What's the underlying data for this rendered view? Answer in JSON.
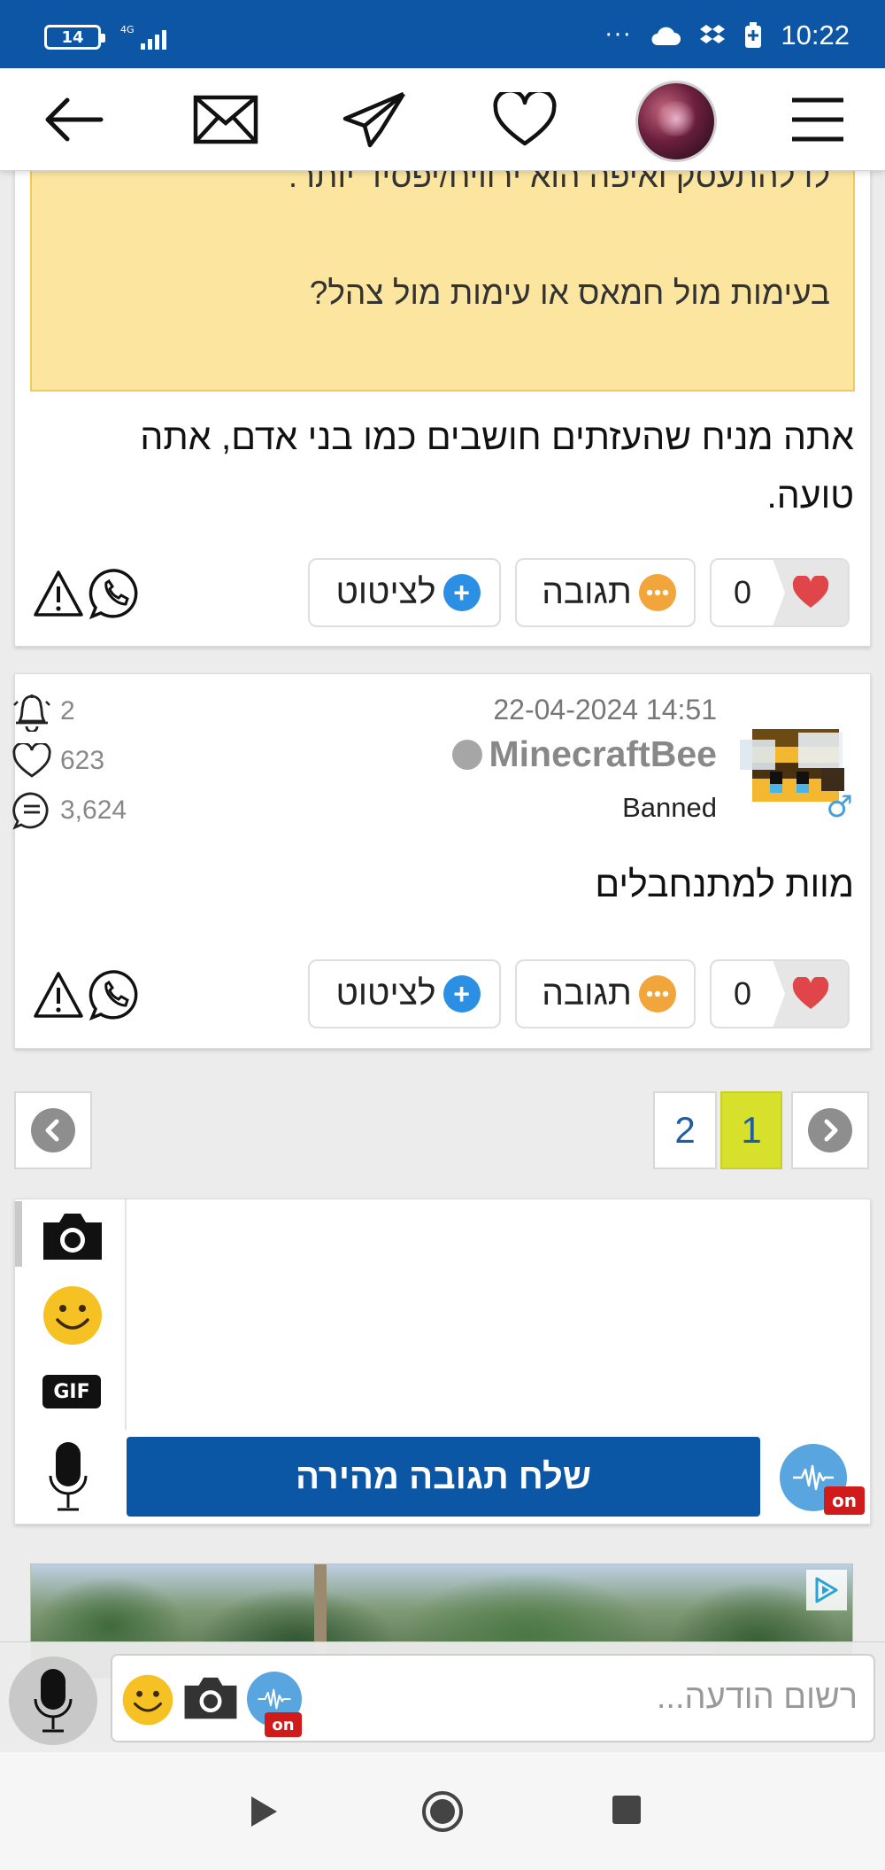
{
  "status_bar": {
    "battery": "14",
    "network": "4G",
    "time": "10:22",
    "icons": [
      "more-dots-icon",
      "cloud-icon",
      "dropbox-icon",
      "battery-saver-icon"
    ]
  },
  "app_bar": {
    "icons": [
      "back-arrow-icon",
      "envelope-icon",
      "paper-plane-icon",
      "heart-icon",
      "user-avatar",
      "hamburger-menu-icon"
    ]
  },
  "post1": {
    "quote_lines": [
      "לו להתעסק ואיפה הוא ירוויח/יפסיד יותר.",
      "בעימות מול חמאס או עימות מול צהל?"
    ],
    "text_lines": [
      "אתה מניח שהעזתים חושבים כמו בני אדם, אתה",
      "טועה."
    ],
    "likes": "0",
    "reply_label": "תגובה",
    "quote_label": "לציטוט"
  },
  "post2": {
    "date": "22-04-2024 14:51",
    "username": "MinecraftBee",
    "role": "Banned",
    "stats": {
      "notifications": "2",
      "likes": "623",
      "comments": "3,624"
    },
    "text": "מוות למתנחבלים",
    "likes": "0",
    "reply_label": "תגובה",
    "quote_label": "לציטוט"
  },
  "pagination": {
    "pages": [
      "2",
      "1"
    ],
    "current": "1"
  },
  "quick_reply": {
    "gif_label": "GIF",
    "send_label": "שלח תגובה מהירה",
    "on_badge": "on"
  },
  "compose": {
    "placeholder": "רשום הודעה...",
    "on_badge": "on"
  },
  "colors": {
    "status_bar": "#0d56a6",
    "accent_blue": "#0c57a5",
    "quote_bg": "#fbe59f",
    "heart_red": "#e0454a",
    "current_page": "#d7e02a"
  }
}
